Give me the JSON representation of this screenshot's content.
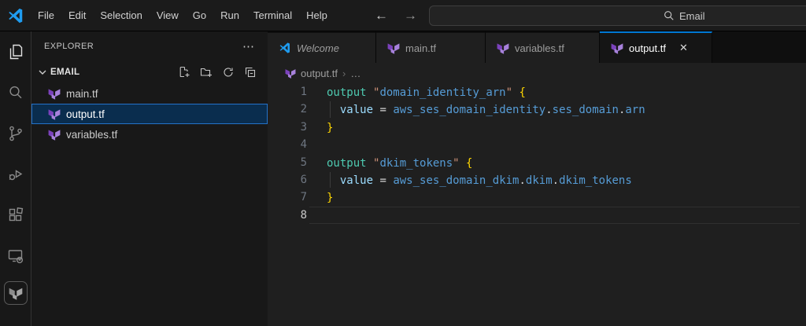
{
  "titlebar": {
    "menu": [
      "File",
      "Edit",
      "Selection",
      "View",
      "Go",
      "Run",
      "Terminal",
      "Help"
    ],
    "back": "←",
    "forward": "→",
    "search_label": "Email"
  },
  "activity_bar": {
    "items": [
      "explorer",
      "search",
      "source-control",
      "run-and-debug",
      "extensions",
      "remote-explorer",
      "terraform"
    ]
  },
  "explorer": {
    "header": "EXPLORER",
    "overflow": "⋯",
    "folder": "EMAIL",
    "files": [
      {
        "name": "main.tf",
        "selected": false
      },
      {
        "name": "output.tf",
        "selected": true
      },
      {
        "name": "variables.tf",
        "selected": false
      }
    ]
  },
  "tabs": [
    {
      "label": "Welcome",
      "icon": "vscode-icon",
      "active": false
    },
    {
      "label": "main.tf",
      "icon": "terraform-icon",
      "active": false
    },
    {
      "label": "variables.tf",
      "icon": "terraform-icon",
      "active": false
    },
    {
      "label": "output.tf",
      "icon": "terraform-icon",
      "active": true,
      "close": "✕"
    }
  ],
  "breadcrumb": {
    "file": "output.tf",
    "sep": "›",
    "more": "…"
  },
  "editor": {
    "language": "terraform",
    "lines": [
      {
        "num": "1",
        "active": false,
        "guide": false,
        "tokens": [
          [
            "output",
            "kw"
          ],
          [
            " ",
            "pl"
          ],
          [
            "\"",
            "q"
          ],
          [
            "domain_identity_arn",
            "lb"
          ],
          [
            "\"",
            "q"
          ],
          [
            " ",
            "pl"
          ],
          [
            "{",
            "br"
          ]
        ]
      },
      {
        "num": "2",
        "active": false,
        "guide": true,
        "tokens": [
          [
            "  ",
            "pl"
          ],
          [
            "value",
            "pr"
          ],
          [
            " ",
            "pl"
          ],
          [
            "=",
            "op"
          ],
          [
            " ",
            "pl"
          ],
          [
            "aws_ses_domain_identity",
            "rf"
          ],
          [
            ".",
            "pt"
          ],
          [
            "ses_domain",
            "rf"
          ],
          [
            ".",
            "pt"
          ],
          [
            "arn",
            "rf"
          ]
        ]
      },
      {
        "num": "3",
        "active": false,
        "guide": false,
        "tokens": [
          [
            "}",
            "br"
          ]
        ]
      },
      {
        "num": "4",
        "active": false,
        "guide": false,
        "tokens": []
      },
      {
        "num": "5",
        "active": false,
        "guide": false,
        "tokens": [
          [
            "output",
            "kw"
          ],
          [
            " ",
            "pl"
          ],
          [
            "\"",
            "q"
          ],
          [
            "dkim_tokens",
            "lb"
          ],
          [
            "\"",
            "q"
          ],
          [
            " ",
            "pl"
          ],
          [
            "{",
            "br"
          ]
        ]
      },
      {
        "num": "6",
        "active": false,
        "guide": true,
        "tokens": [
          [
            "  ",
            "pl"
          ],
          [
            "value",
            "pr"
          ],
          [
            " ",
            "pl"
          ],
          [
            "=",
            "op"
          ],
          [
            " ",
            "pl"
          ],
          [
            "aws_ses_domain_dkim",
            "rf"
          ],
          [
            ".",
            "pt"
          ],
          [
            "dkim",
            "rf"
          ],
          [
            ".",
            "pt"
          ],
          [
            "dkim_tokens",
            "rf"
          ]
        ]
      },
      {
        "num": "7",
        "active": false,
        "guide": false,
        "tokens": [
          [
            "}",
            "br"
          ]
        ]
      },
      {
        "num": "8",
        "active": true,
        "guide": false,
        "tokens": []
      }
    ]
  },
  "colors": {
    "accent": "#0078d4",
    "selection_background": "#0a2d4e",
    "selection_border": "#2472c8",
    "editor_background": "#1f1f1f",
    "sidebar_background": "#181818",
    "terraform_purple_dark": "#7B42BC",
    "terraform_purple_light": "#A781DB",
    "keyword": "#4EC9B0",
    "string_quote": "#CE9178",
    "string_label": "#569CD6",
    "property": "#9CDCFE",
    "brace": "#FFD700"
  }
}
